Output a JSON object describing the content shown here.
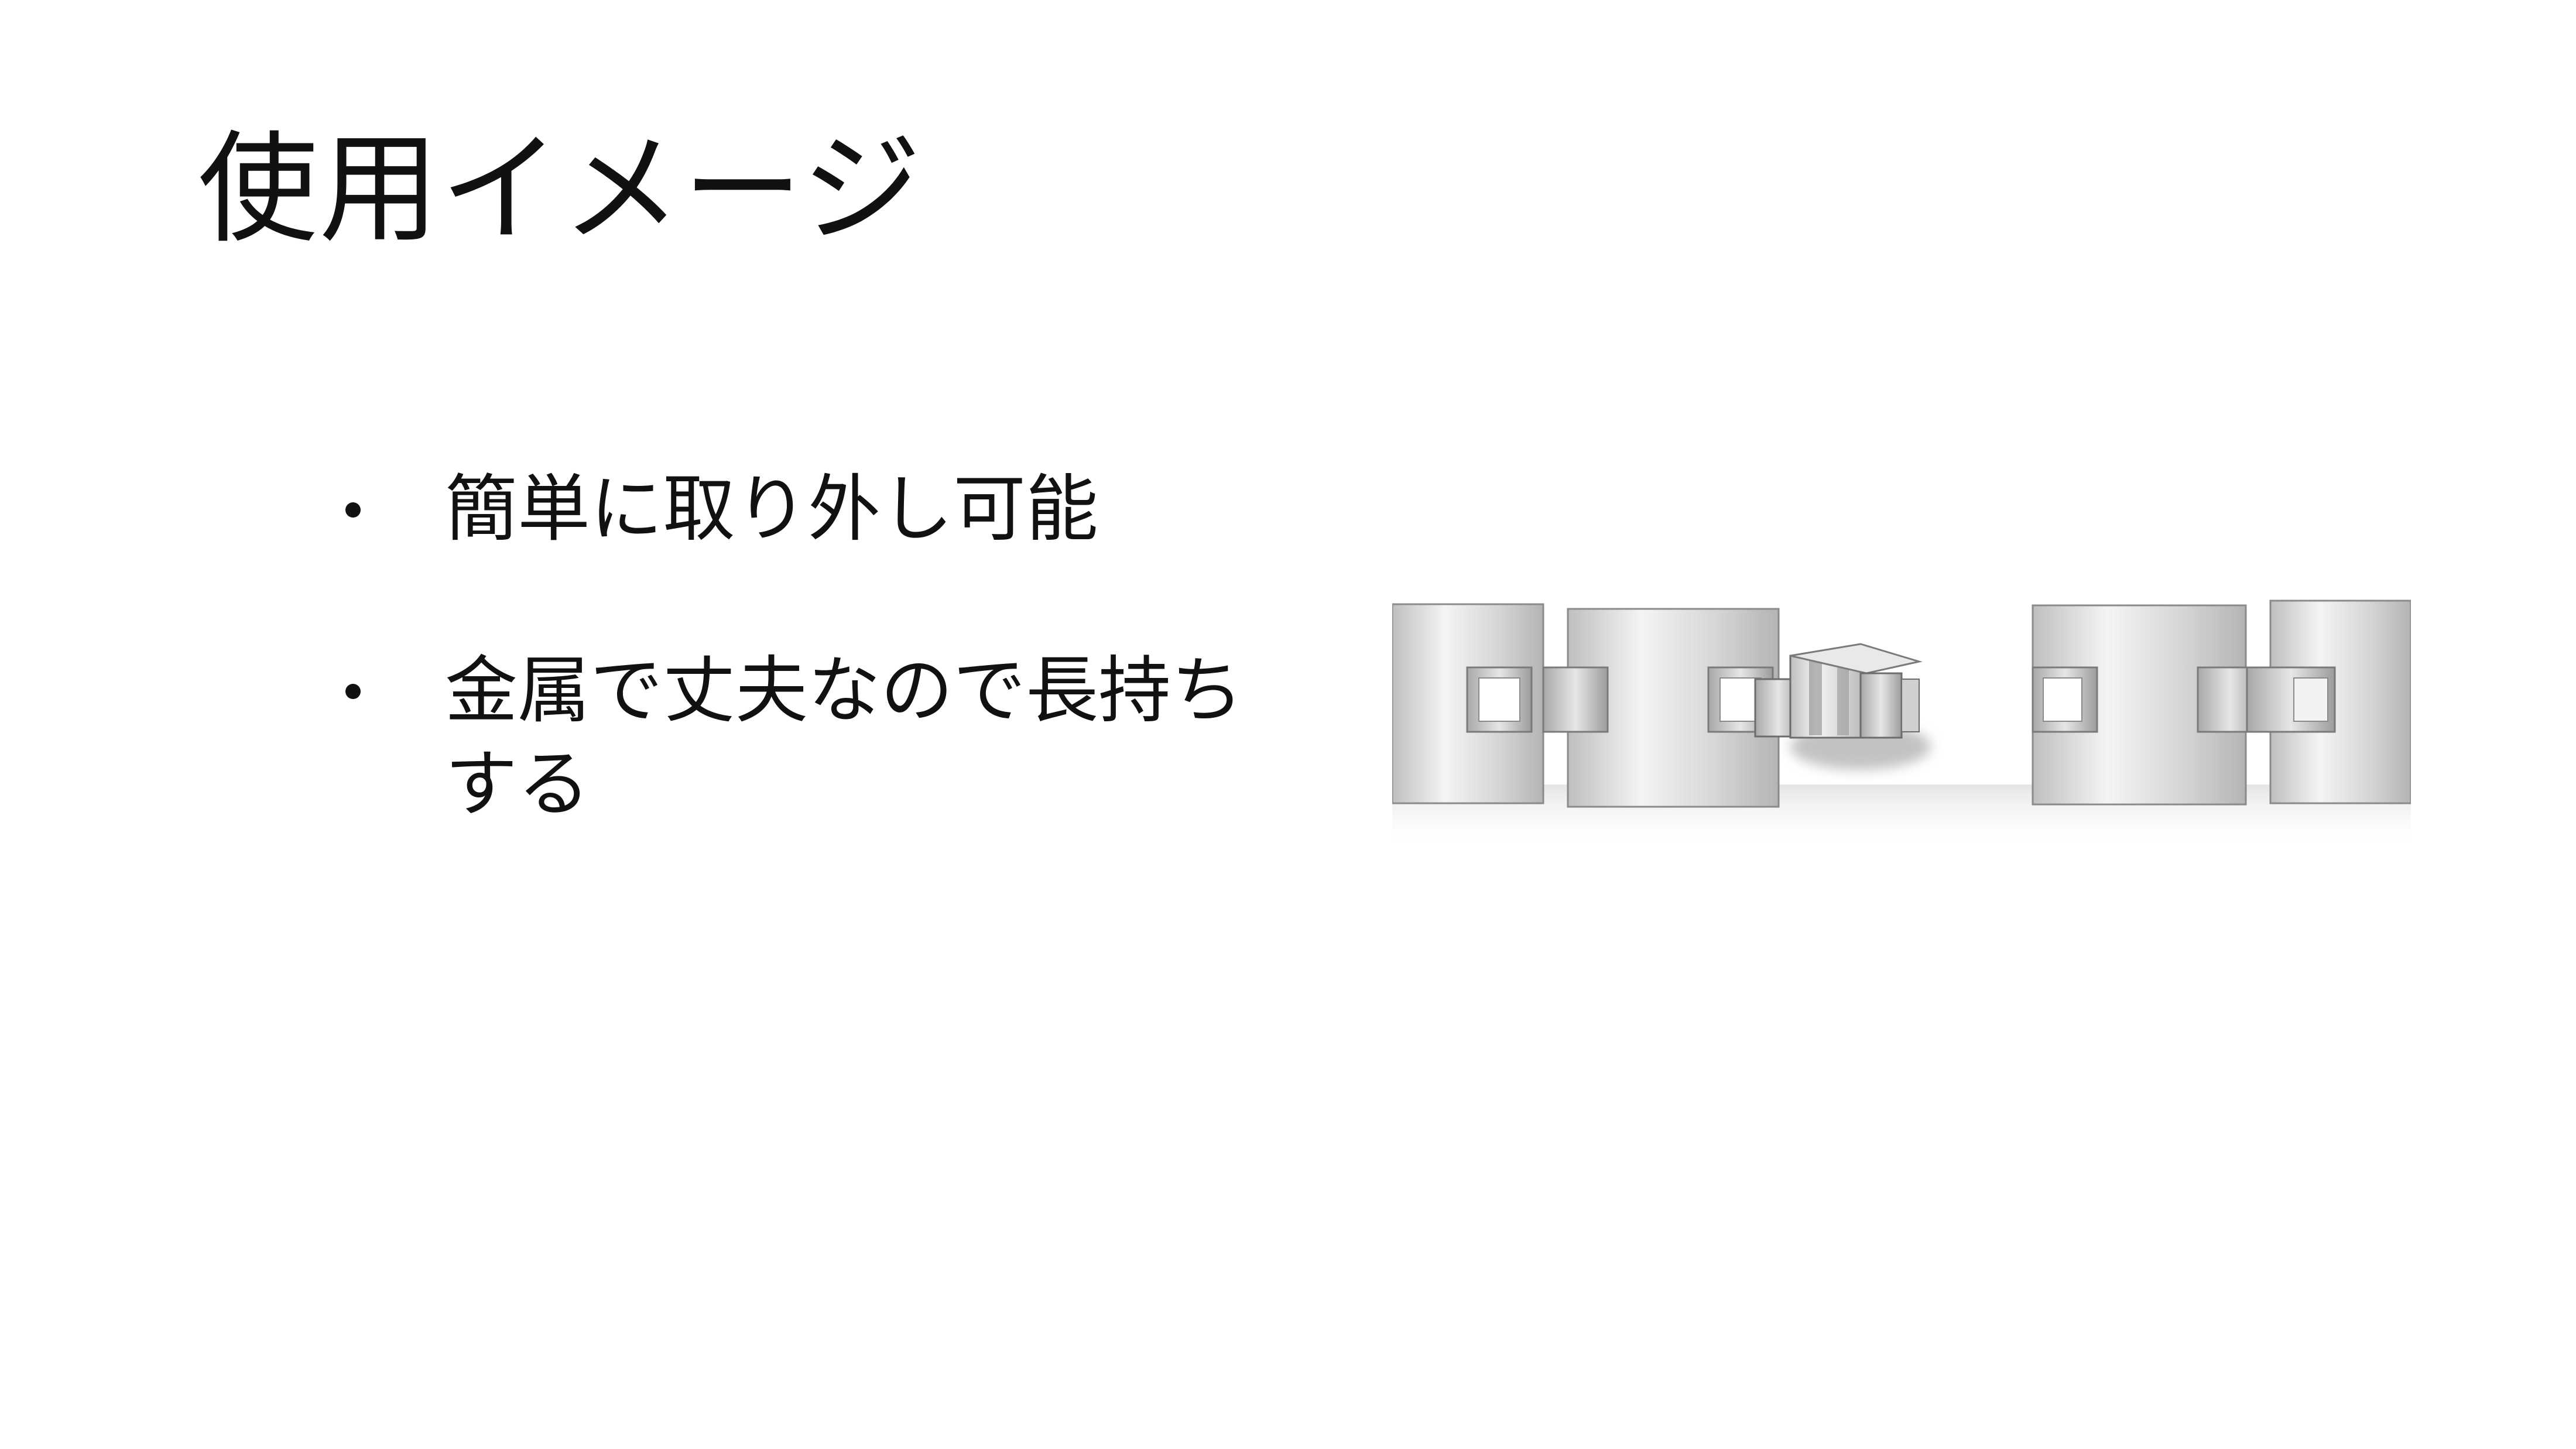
{
  "slide": {
    "title": "使用イメージ",
    "bullets": [
      "簡単に取り外し可能",
      "金属で丈夫なので長持ちする"
    ],
    "image": {
      "name": "metal-bracelet-links",
      "base_color": "#cfcfcf",
      "highlight_color": "#f4f4f4",
      "shadow_color": "#9a9a9a"
    }
  }
}
